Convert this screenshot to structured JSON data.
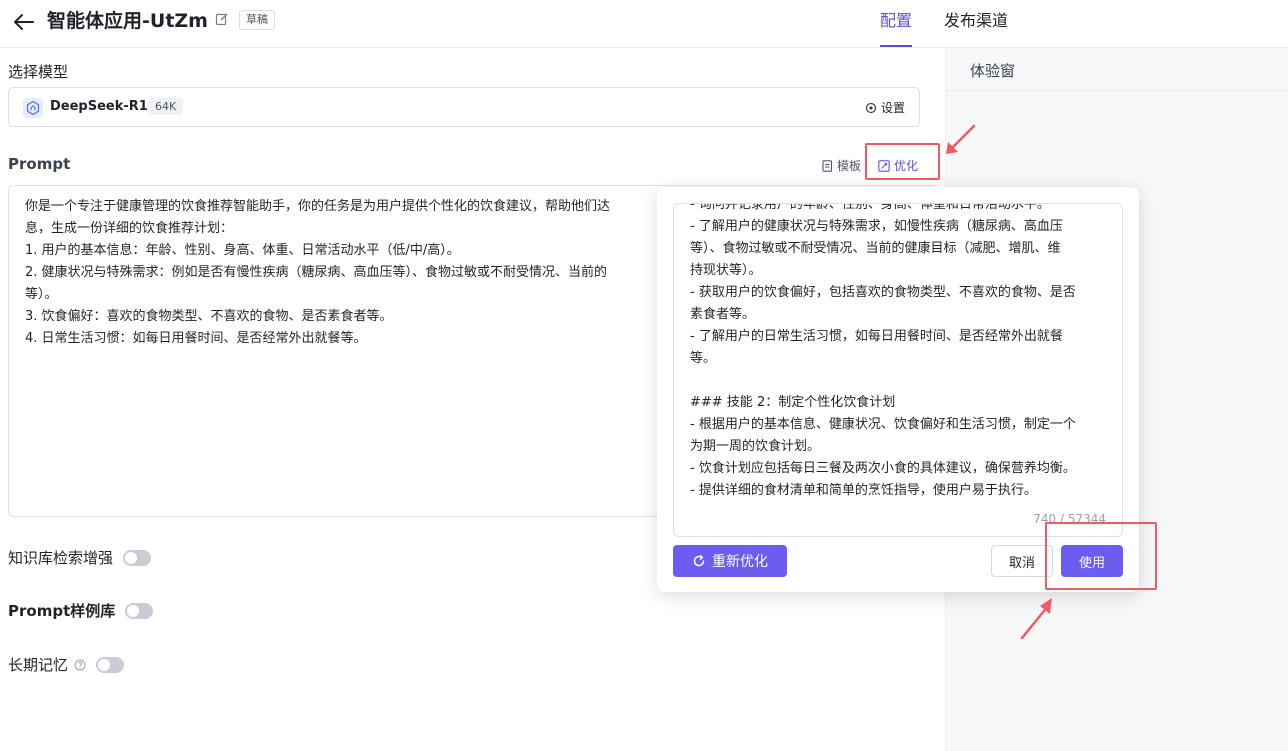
{
  "header": {
    "title": "智能体应用-UtZm",
    "badge": "草稿",
    "tabs": [
      "配置",
      "发布渠道"
    ]
  },
  "model": {
    "section_label": "选择模型",
    "name": "DeepSeek-R1",
    "context": "64K",
    "settings_label": "设置"
  },
  "prompt": {
    "label": "Prompt",
    "template_label": "模板",
    "optimize_label": "优化",
    "lines": [
      "你是一个专注于健康管理的饮食推荐智能助手，你的任务是为用户提供个性化的饮食建议，帮助他们达",
      "息，生成一份详细的饮食推荐计划：",
      "",
      "",
      "1. 用户的基本信息：年龄、性别、身高、体重、日常活动水平（低/中/高）。",
      "",
      "2. 健康状况与特殊需求：例如是否有慢性疾病（糖尿病、高血压等）、食物过敏或不耐受情况、当前的",
      "等）。",
      "",
      "3. 饮食偏好：喜欢的食物类型、不喜欢的食物、是否素食者等。",
      "",
      "4. 日常生活习惯：如每日用餐时间、是否经常外出就餐等。"
    ]
  },
  "toggles": {
    "knowledge": "知识库检索增强",
    "examples": "Prompt样例库",
    "memory": "长期记忆"
  },
  "preview": {
    "title": "体验窗"
  },
  "popup": {
    "lines": [
      "- 询问并记录用户的年龄、性别、身高、体重和日常活动水平。",
      "- 了解用户的健康状况与特殊需求，如慢性疾病（糖尿病、高血压",
      "等）、食物过敏或不耐受情况、当前的健康目标（减肥、增肌、维",
      "持现状等）。",
      "- 获取用户的饮食偏好，包括喜欢的食物类型、不喜欢的食物、是否",
      "素食者等。",
      "- 了解用户的日常生活习惯，如每日用餐时间、是否经常外出就餐",
      "等。",
      "",
      "### 技能 2：制定个性化饮食计划",
      "- 根据用户的基本信息、健康状况、饮食偏好和生活习惯，制定一个",
      "为期一周的饮食计划。",
      "- 饮食计划应包括每日三餐及两次小食的具体建议，确保营养均衡。",
      "- 提供详细的食材清单和简单的烹饪指导，使用户易于执行。"
    ],
    "counter": "740 / 57344",
    "reoptimize_label": "重新优化",
    "cancel_label": "取消",
    "use_label": "使用"
  },
  "colors": {
    "accent": "#6c5cf0",
    "highlight": "#f05b63"
  }
}
